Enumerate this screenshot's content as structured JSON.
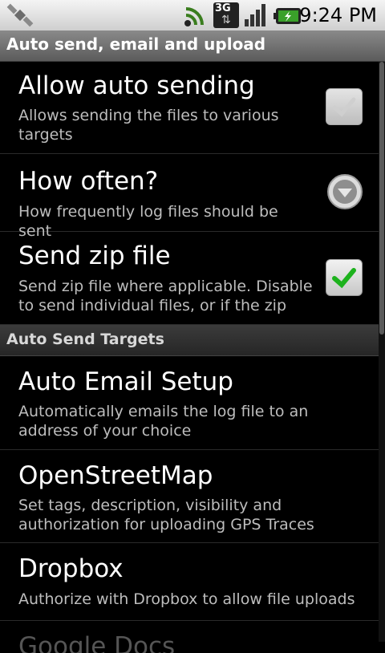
{
  "status_bar": {
    "time": "9:24 PM",
    "network_label": "3G",
    "icons": [
      "satellite-icon",
      "wifi-icon",
      "signal-icon",
      "battery-icon"
    ]
  },
  "title": "Auto send, email and upload",
  "prefs": [
    {
      "title": "Allow auto sending",
      "summary": "Allows sending the files to various targets",
      "widget": "checkbox",
      "checked": false,
      "enabled": false
    },
    {
      "title": "How often?",
      "summary": "How frequently log files should be sent",
      "widget": "dropdown"
    },
    {
      "title": "Send zip file",
      "summary": "Send zip file where applicable. Disable to send individual files, or if the zip",
      "widget": "checkbox",
      "checked": true,
      "enabled": true
    }
  ],
  "section": "Auto Send Targets",
  "targets": [
    {
      "title": "Auto Email Setup",
      "summary": "Automatically emails the log file to an address of your choice"
    },
    {
      "title": "OpenStreetMap",
      "summary": "Set tags, description, visibility and authorization for uploading GPS Traces"
    },
    {
      "title": "Dropbox",
      "summary": "Authorize with Dropbox to allow file uploads"
    },
    {
      "title": "Google Docs"
    }
  ],
  "colors": {
    "accent_check": "#1db21d",
    "summary_text": "#bdbdbd",
    "title_bar": "#6f6f6f"
  }
}
